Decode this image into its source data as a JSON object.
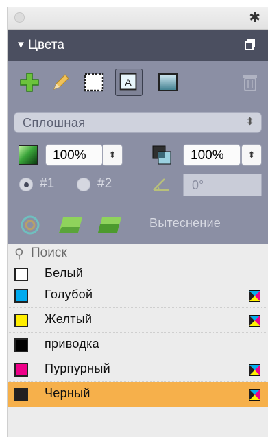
{
  "palette": {
    "title": "Цвета",
    "tools": [
      "add-color",
      "edit-color",
      "frame-color",
      "text-color",
      "background-color",
      "delete-color"
    ],
    "fill_type": "Сплошная",
    "opacity1": "100%",
    "opacity2": "100%",
    "radio1_label": "#1",
    "radio2_label": "#2",
    "angle": "0°",
    "knockout_label": "Вытеснение",
    "search_placeholder": "Поиск"
  },
  "swatches": [
    {
      "name": "Белый",
      "color": "#ffffff",
      "cmyk_icon": false
    },
    {
      "name": "Голубой",
      "color": "#00aaee",
      "cmyk_icon": true
    },
    {
      "name": "Желтый",
      "color": "#ffee00",
      "cmyk_icon": true
    },
    {
      "name": "приводка",
      "color": "#000000",
      "cmyk_icon": false
    },
    {
      "name": "Пурпурный",
      "color": "#ee0088",
      "cmyk_icon": true
    },
    {
      "name": "Черный",
      "color": "#231f20",
      "cmyk_icon": true,
      "selected": true
    }
  ],
  "colors": {
    "header_bg": "#4b4f60",
    "panel_bg": "#8b8fa4",
    "selection": "#f6b04b"
  }
}
